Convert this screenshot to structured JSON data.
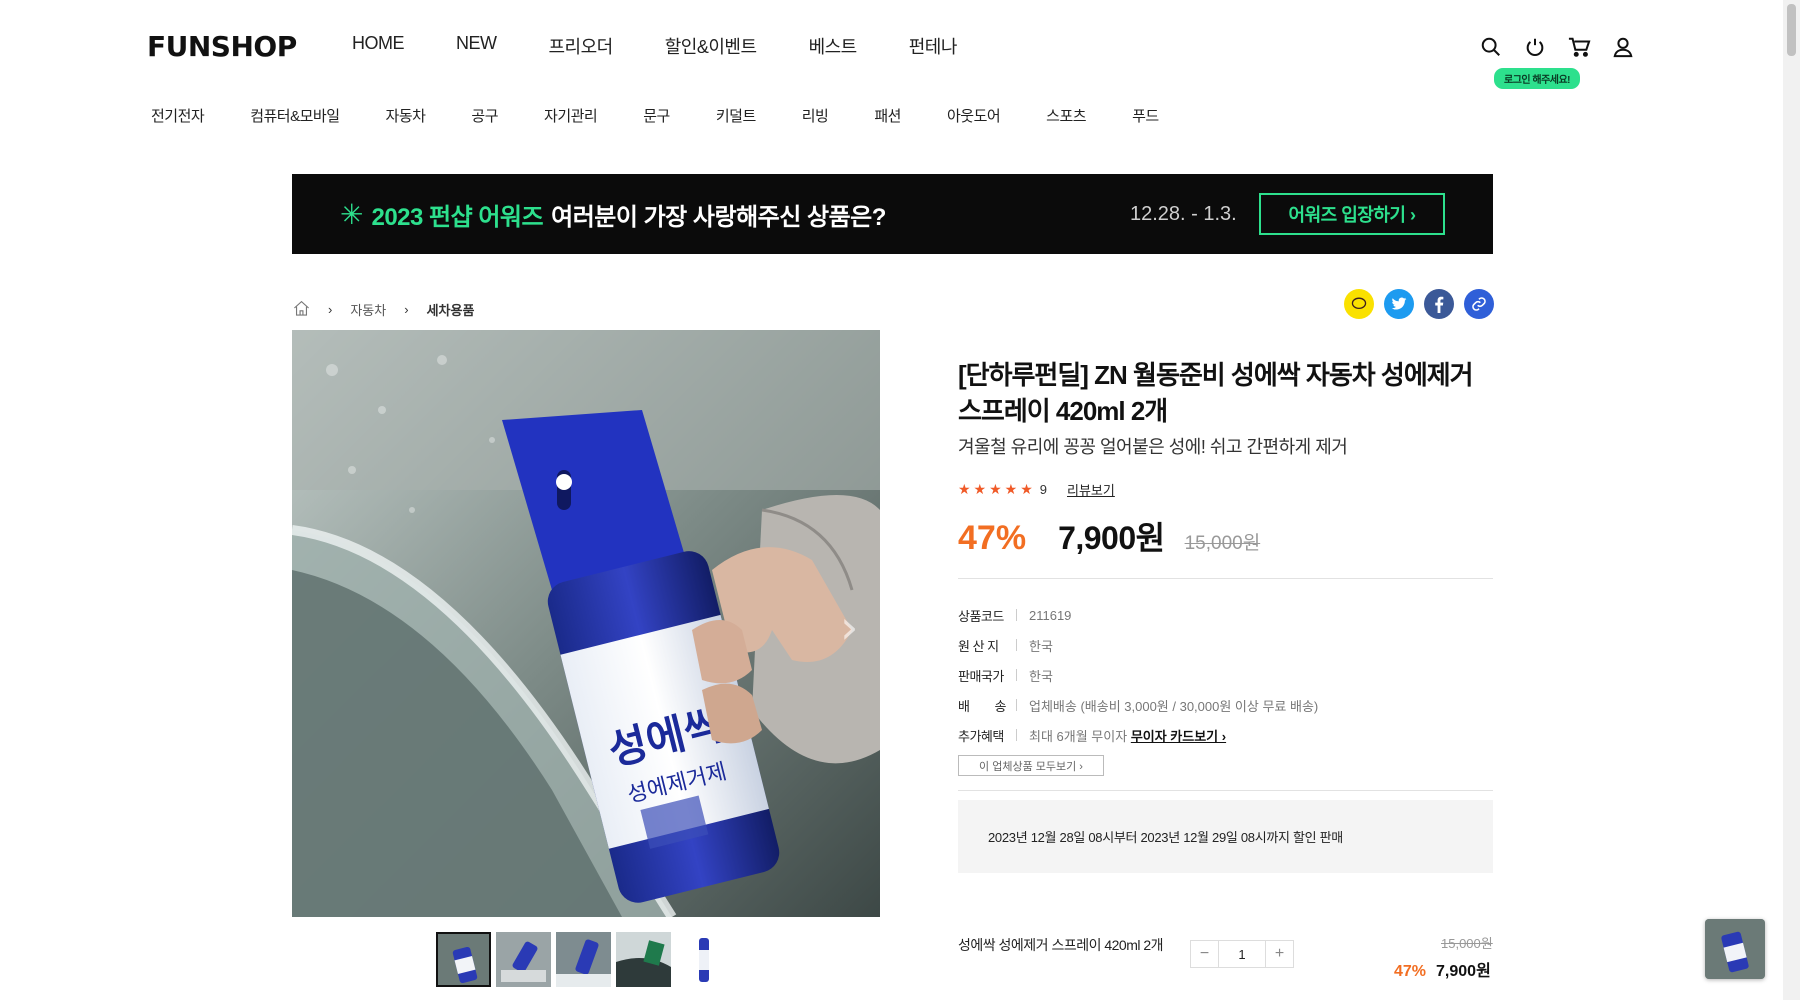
{
  "header": {
    "logo": "FUNSHOP",
    "nav": [
      "HOME",
      "NEW",
      "프리오더",
      "할인&이벤트",
      "베스트",
      "펀테나"
    ],
    "login_tip": "로그인 해주세요!",
    "icons": [
      "search-icon",
      "power-icon",
      "cart-icon",
      "user-icon"
    ]
  },
  "categories": [
    "전기전자",
    "컴퓨터&모바일",
    "자동차",
    "공구",
    "자기관리",
    "문구",
    "키덜트",
    "리빙",
    "패션",
    "아웃도어",
    "스포츠",
    "푸드"
  ],
  "banner": {
    "star": "✳",
    "title_green": "2023 펀샵 어워즈",
    "title_white": "여러분이 가장 사랑해주신 상품은?",
    "date": "12.28. - 1.3.",
    "button": "어워즈 입장하기 ›"
  },
  "breadcrumb": {
    "level1": "자동차",
    "level2": "세차용품"
  },
  "product": {
    "title": "[단하루펀딜] ZN 월동준비 성에싹 자동차 성에제거 스프레이 420ml 2개",
    "subtitle": "겨울철 유리에 꽁꽁 얼어붙은 성에! 쉬고 간편하게 제거",
    "rating_stars": "★★★★★",
    "review_count": "9",
    "review_link": "리뷰보기",
    "discount": "47%",
    "price": "7,900원",
    "original_price": "15,000원",
    "can_text": "성에싹",
    "can_sub": "성에제거제",
    "specs": [
      {
        "key": "상품코드",
        "value": "211619"
      },
      {
        "key": "원 산 지",
        "value": "한국"
      },
      {
        "key": "판매국가",
        "value": "한국"
      },
      {
        "key": "배　　송",
        "value": "업체배송 (배송비 3,000원 / 30,000원 이상 무료 배송)"
      }
    ],
    "benefit_key": "추가혜택",
    "benefit_value": "최대 6개월 무이자",
    "benefit_link": "무이자 카드보기 ›",
    "all_products_button": "이 업체상품 모두보기 ›",
    "notice": "2023년 12월 28일 08시부터 2023년 12월 29일 08시까지 할인 판매"
  },
  "option": {
    "name": "성에싹 성에제거 스프레이 420ml 2개",
    "qty": "1",
    "minus": "−",
    "plus": "+",
    "original_price": "15,000원",
    "discount": "47%",
    "price": "7,900원"
  },
  "colors": {
    "accent_green": "#2de08d",
    "discount_orange": "#f26e22",
    "kakao": "#fae100",
    "twitter": "#1d9bf0",
    "facebook": "#3b5998",
    "link": "#2f5fd8"
  }
}
